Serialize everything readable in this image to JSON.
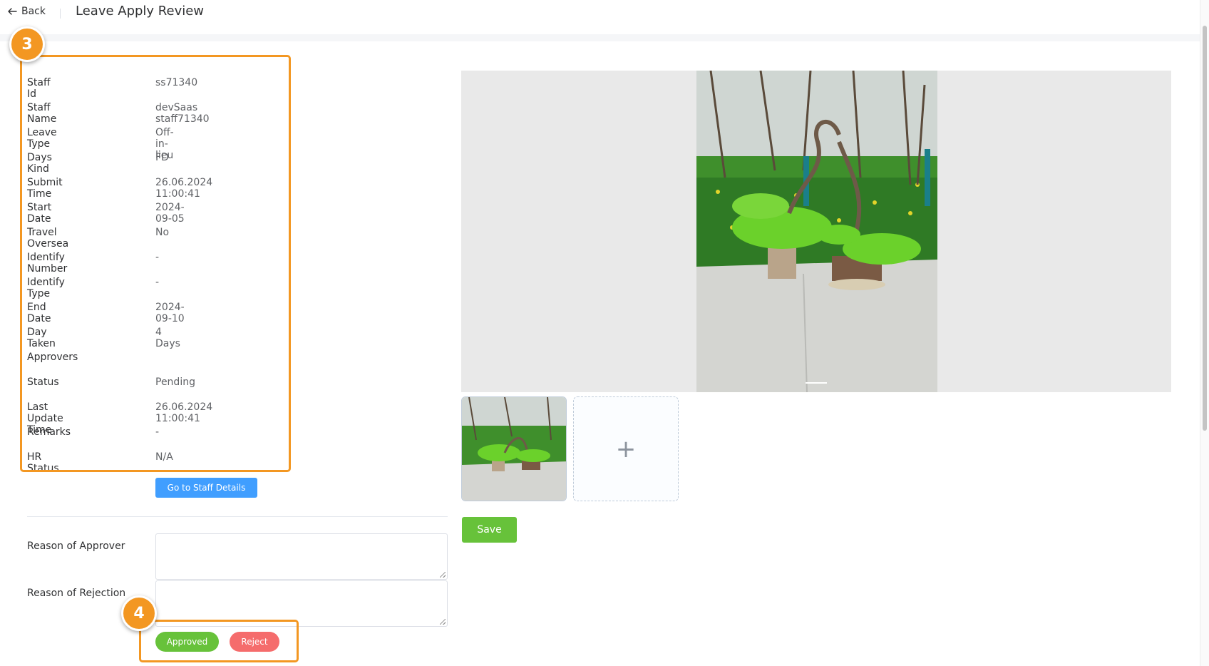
{
  "header": {
    "back_label": "Back",
    "title": "Leave Apply Review"
  },
  "steps": {
    "step_a": "3",
    "step_b": "4"
  },
  "details": [
    {
      "label": "Staff Id",
      "value": "ss71340"
    },
    {
      "label": "Staff Name",
      "value": "devSaas staff71340"
    },
    {
      "label": "Leave Type",
      "value": "Off-in-lieu"
    },
    {
      "label": "Days Kind",
      "value": "FD"
    },
    {
      "label": "Submit Time",
      "value": "26.06.2024 11:00:41"
    },
    {
      "label": "Start Date",
      "value": "2024-09-05"
    },
    {
      "label": "Travel Oversea",
      "value": "No"
    },
    {
      "label": "Identify Number",
      "value": "-"
    },
    {
      "label": "Identify Type",
      "value": "-"
    },
    {
      "label": "End Date",
      "value": "2024-09-10"
    },
    {
      "label": "Day Taken",
      "value": "4 Days"
    },
    {
      "label": "Approvers",
      "value": ""
    },
    {
      "label": "Status",
      "value": "Pending"
    },
    {
      "label": "Last Update Time",
      "value": "26.06.2024 11:00:41"
    },
    {
      "label": "Remarks",
      "value": "-"
    },
    {
      "label": "HR Status",
      "value": "N/A"
    }
  ],
  "actions": {
    "staff_details_label": "Go to Staff Details",
    "approved_label": "Approved",
    "reject_label": "Reject",
    "save_label": "Save"
  },
  "form": {
    "reason_approver_label": "Reason of Approver",
    "reason_approver_value": "",
    "reason_rejection_label": "Reason of Rejection",
    "reason_rejection_value": ""
  },
  "upload": {
    "plus_icon": "+"
  },
  "colors": {
    "highlight": "#f39722",
    "primary": "#409eff",
    "success": "#67c23a",
    "danger": "#f56c6c"
  }
}
